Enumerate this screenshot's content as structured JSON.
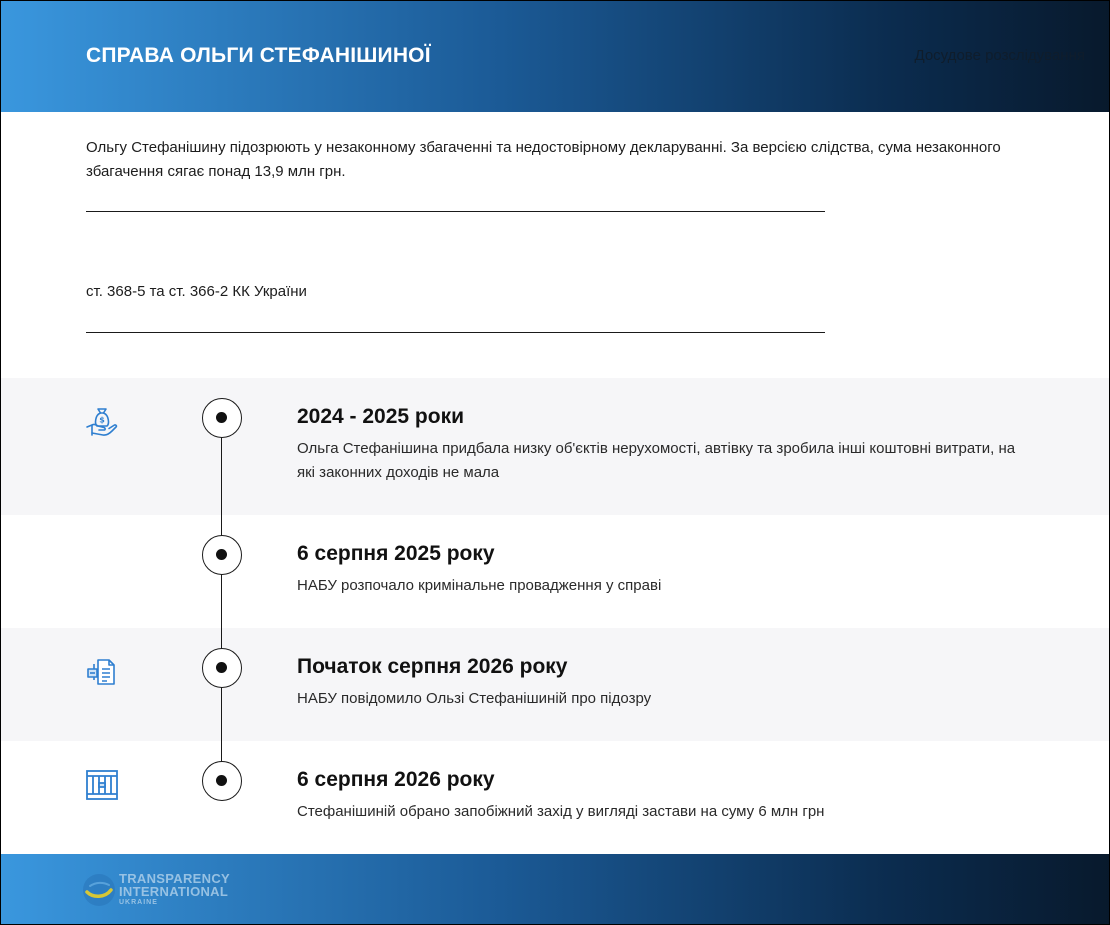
{
  "header": {
    "title": "СПРАВА ОЛЬГИ СТЕФАНІШИНОЇ",
    "subtitle": "Досудове розслідування"
  },
  "intro": {
    "text": "Ольгу Стефанішину підозрюють у незаконному збагаченні та недостовірному декларуванні. За версією слідства, сума незаконного збагачення сягає понад 13,9 млн грн.",
    "articles": "ст. 368-5 та ст. 366-2 КК України"
  },
  "timeline": [
    {
      "date": "2024 - 2025 роки",
      "text": "Ольга Стефанішина придбала низку об'єктів нерухомості, автівку та зробила інші коштовні витрати, на які законних доходів не мала",
      "icon": "money-bag-hand-icon"
    },
    {
      "date": "6 серпня 2025 року",
      "text": "НАБУ розпочало кримінальне провадження у справі",
      "icon": ""
    },
    {
      "date": "Початок серпня 2026 року",
      "text": "НАБУ повідомило Ользі Стефанішиній про підозру",
      "icon": "documents-icon"
    },
    {
      "date": "6 серпня 2026 року",
      "text": "Стефанішиній обрано запобіжний захід у вигляді застави на суму 6 млн грн",
      "icon": "prison-bars-icon"
    }
  ],
  "footer": {
    "logo_line1": "TRANSPARENCY",
    "logo_line2": "INTERNATIONAL",
    "logo_line3": "UKRAINE"
  },
  "colors": {
    "gradient_start": "#3a97de",
    "gradient_end": "#08192c",
    "icon_blue": "#2f7fd0",
    "shaded_row": "#f6f6f8"
  }
}
